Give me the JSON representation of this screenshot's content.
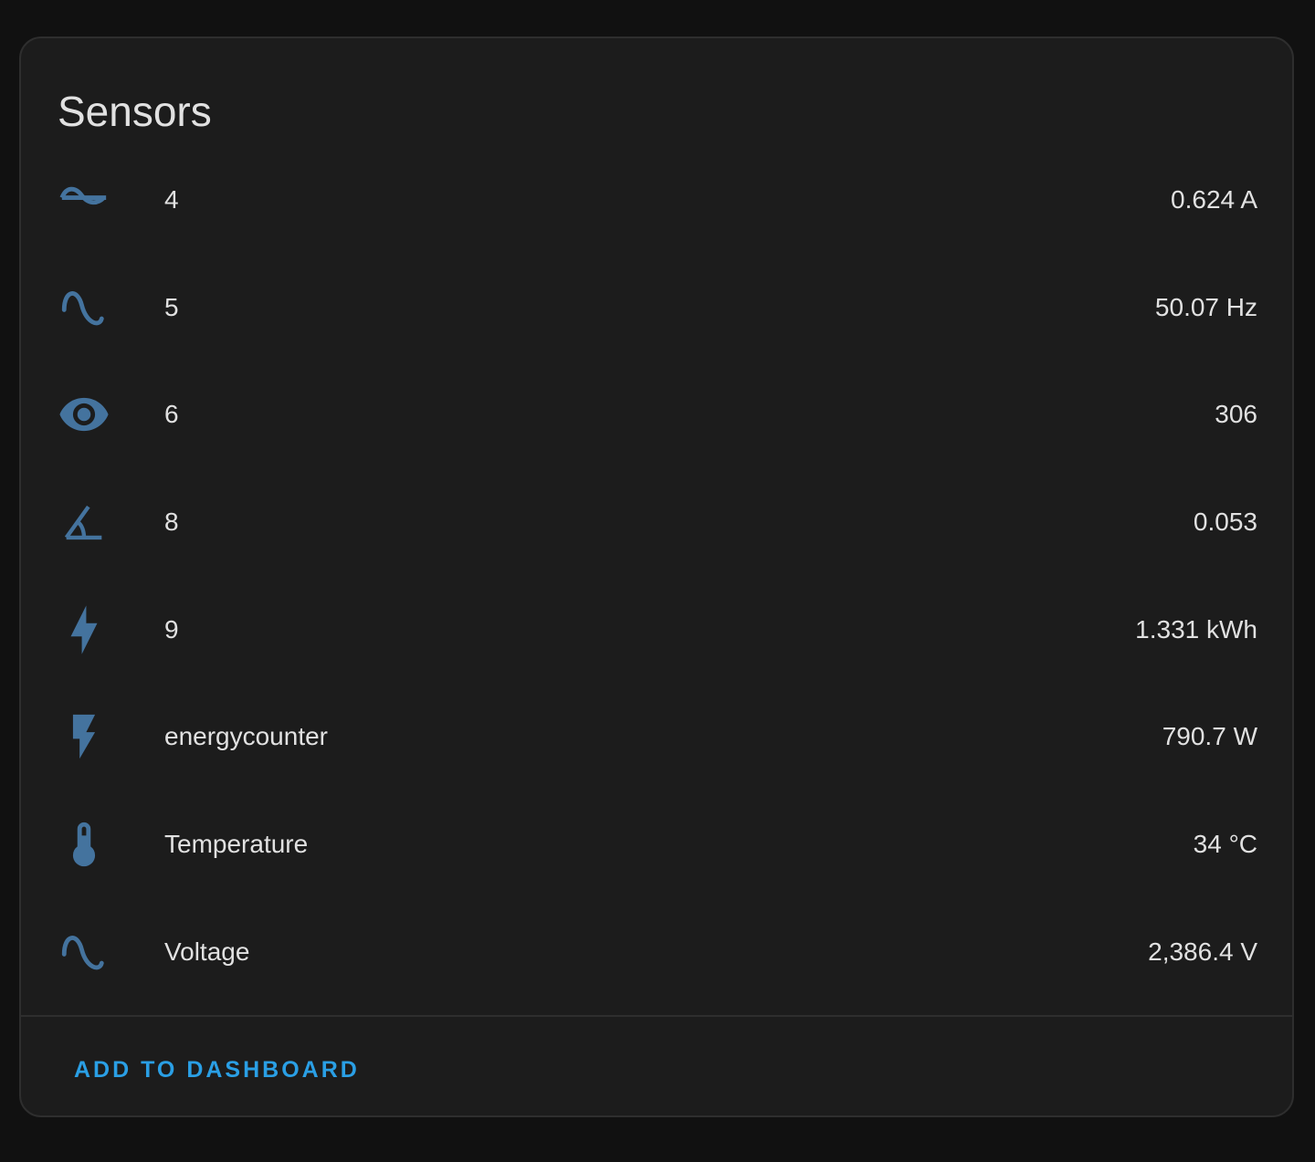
{
  "card": {
    "title": "Sensors",
    "action_label": "ADD TO DASHBOARD"
  },
  "colors": {
    "icon": "#44739e",
    "accent": "#2a9fe5",
    "text": "#e1e1e1",
    "card_bg": "#1c1c1c",
    "page_bg": "#111111"
  },
  "sensors": [
    {
      "icon": "current-ac-icon",
      "name": "4",
      "value": "0.624 A"
    },
    {
      "icon": "sine-wave-icon",
      "name": "5",
      "value": "50.07 Hz"
    },
    {
      "icon": "eye-icon",
      "name": "6",
      "value": "306"
    },
    {
      "icon": "angle-acute-icon",
      "name": "8",
      "value": "0.053"
    },
    {
      "icon": "lightning-bolt-icon",
      "name": "9",
      "value": "1.331 kWh"
    },
    {
      "icon": "flash-icon",
      "name": "energycounter",
      "value": "790.7 W"
    },
    {
      "icon": "thermometer-icon",
      "name": "Temperature",
      "value": "34 °C"
    },
    {
      "icon": "sine-wave-icon",
      "name": "Voltage",
      "value": "2,386.4 V"
    }
  ]
}
